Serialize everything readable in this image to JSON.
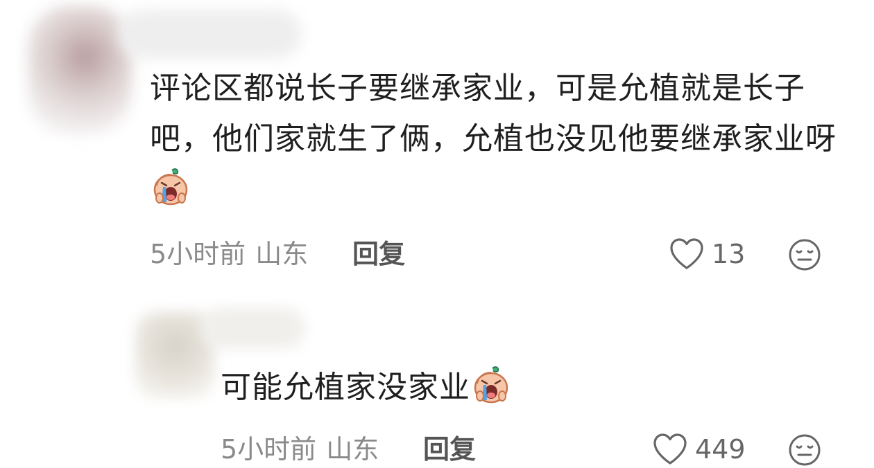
{
  "comments": [
    {
      "text": "评论区都说长子要继承家业，可是允植就是长子吧，他们家就生了俩，允植也没见他要继承家业呀",
      "emoji": "crying-peach-emoji",
      "time": "5小时前",
      "location": "山东",
      "reply_label": "回复",
      "likes": "13"
    },
    {
      "text": "可能允植家没家业",
      "emoji": "crying-peach-emoji",
      "time": "5小时前",
      "location": "山东",
      "reply_label": "回复",
      "likes": "449"
    }
  ],
  "icons": {
    "like": "heart-outline-icon",
    "dislike": "meh-face-icon"
  },
  "colors": {
    "text": "#1f1f1f",
    "meta": "#8a8a8a",
    "reply": "#555555"
  }
}
